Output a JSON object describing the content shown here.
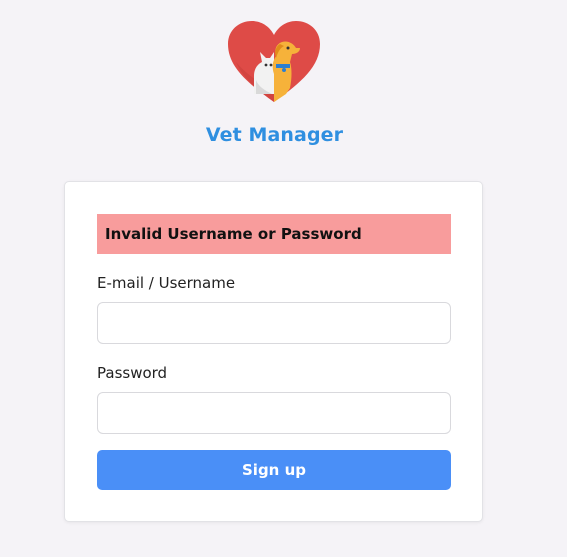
{
  "app": {
    "title": "Vet Manager",
    "logo_icon": "heart-pets-logo-icon"
  },
  "login": {
    "error_message": "Invalid Username or Password",
    "username_label": "E-mail / Username",
    "username_value": "",
    "password_label": "Password",
    "password_value": "",
    "submit_label": "Sign up"
  },
  "colors": {
    "background": "#f5f3f7",
    "title": "#2f8fe0",
    "error_bg": "#f89c9c",
    "button": "#4a8ff7"
  }
}
